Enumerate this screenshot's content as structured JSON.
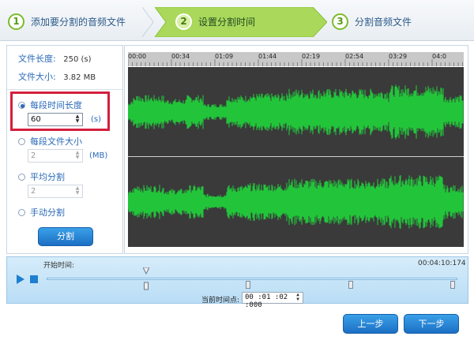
{
  "steps": [
    {
      "num": "1",
      "label": "添加要分割的音频文件"
    },
    {
      "num": "2",
      "label": "设置分割时间"
    },
    {
      "num": "3",
      "label": "分割音频文件"
    }
  ],
  "info": {
    "length_label": "文件长度:",
    "length_value": "250 (s)",
    "size_label": "文件大小:",
    "size_value": "3.82 MB"
  },
  "options": {
    "per_length": {
      "label": "每段时间长度",
      "value": "60",
      "unit": "(s)",
      "selected": true
    },
    "per_size": {
      "label": "每段文件大小",
      "value": "2",
      "unit": "(MB)"
    },
    "average": {
      "label": "平均分割",
      "value": "2"
    },
    "manual": {
      "label": "手动分割"
    }
  },
  "split_button": "分割",
  "timeline_labels": [
    "00:00",
    "00:34",
    "01:09",
    "01:44",
    "02:19",
    "02:54",
    "03:29",
    "04:0"
  ],
  "player": {
    "start_label": "开始时间:",
    "end_time": "00:04:10:174",
    "current_label": "当前时间点:",
    "current_value": "00 :01 :02 :000"
  },
  "nav": {
    "prev": "上一步",
    "next": "下一步"
  },
  "colors": {
    "wave": "#22c53a",
    "accent": "#2a69b8",
    "highlight": "#d41f3d"
  }
}
